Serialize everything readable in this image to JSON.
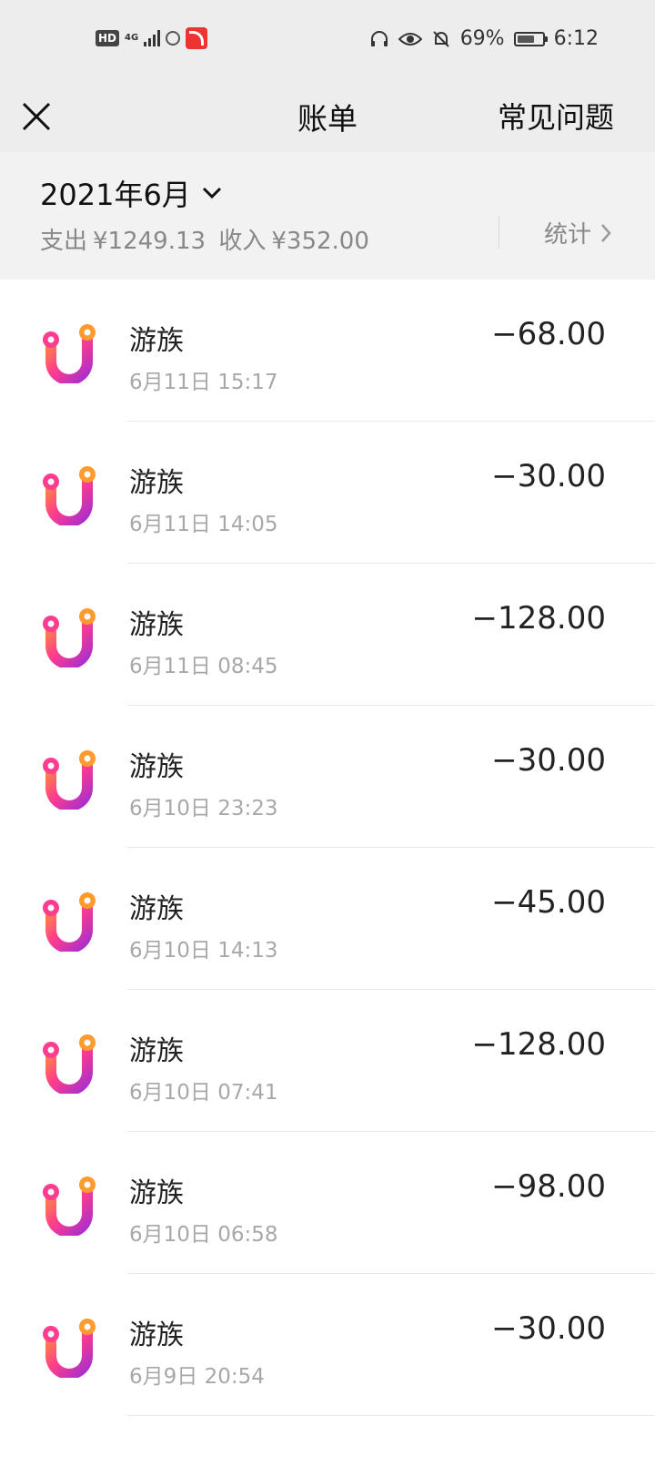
{
  "status_bar": {
    "hd": "HD",
    "network": "4G",
    "battery_pct": "69%",
    "time": "6:12"
  },
  "nav": {
    "title": "账单",
    "faq": "常见问题"
  },
  "summary": {
    "month": "2021年6月",
    "expense_label": "支出",
    "expense": "¥1249.13",
    "income_label": "收入",
    "income": "¥352.00",
    "stats": "统计"
  },
  "transactions": [
    {
      "name": "游族",
      "time": "6月11日 15:17",
      "amount": "−68.00"
    },
    {
      "name": "游族",
      "time": "6月11日 14:05",
      "amount": "−30.00"
    },
    {
      "name": "游族",
      "time": "6月11日 08:45",
      "amount": "−128.00"
    },
    {
      "name": "游族",
      "time": "6月10日 23:23",
      "amount": "−30.00"
    },
    {
      "name": "游族",
      "time": "6月10日 14:13",
      "amount": "−45.00"
    },
    {
      "name": "游族",
      "time": "6月10日 07:41",
      "amount": "−128.00"
    },
    {
      "name": "游族",
      "time": "6月10日 06:58",
      "amount": "−98.00"
    },
    {
      "name": "游族",
      "time": "6月9日 20:54",
      "amount": "−30.00"
    }
  ]
}
